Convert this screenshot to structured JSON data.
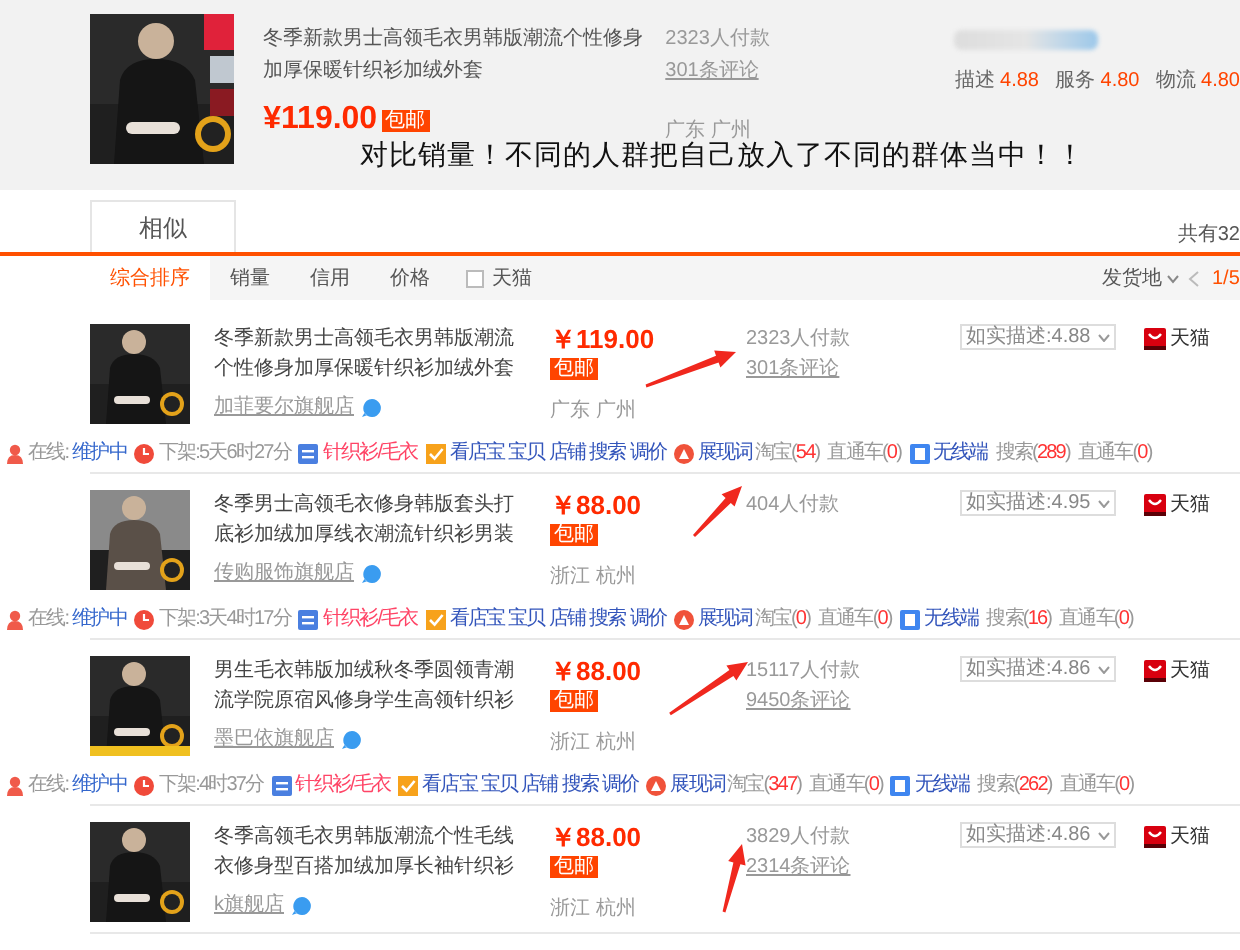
{
  "header_product": {
    "title": "冬季新款男士高领毛衣男韩版潮流个性修身加厚保暖针织衫加绒外套",
    "price": "¥119.00",
    "badge": "包邮",
    "sales": "2323人付款",
    "reviews": "301条评论",
    "location": "广东 广州",
    "ratings": [
      {
        "label": "描述",
        "value": "4.88"
      },
      {
        "label": "服务",
        "value": "4.80"
      },
      {
        "label": "物流",
        "value": "4.80"
      }
    ]
  },
  "annotation": {
    "text": "对比销量！不同的人群把自己放入了不同的群体当中！！"
  },
  "tabs": [
    {
      "label": "相似",
      "selected": true
    }
  ],
  "total_count": "共有32",
  "sort_options": [
    {
      "label": "综合排序",
      "selected": true
    },
    {
      "label": "销量",
      "selected": false
    },
    {
      "label": "信用",
      "selected": false
    },
    {
      "label": "价格",
      "selected": false
    }
  ],
  "tmall_filter": {
    "label": "天猫",
    "checked": false
  },
  "ship_from": "发货地",
  "pager": "1/5",
  "products": [
    {
      "title": "冬季新款男士高领毛衣男韩版潮流个性修身加厚保暖针织衫加绒外套",
      "shop": "加菲要尔旗舰店",
      "price": "￥119.00",
      "badge": "包邮",
      "location": "广东 广州",
      "sales": "2323人付款",
      "reviews": "301条评论",
      "rating": "如实描述:4.88",
      "store_type": "天猫",
      "online_label": "在线:",
      "online_status": "维护中",
      "delist": "下架:5天6时27分",
      "category": "针织衫/毛衣",
      "tools": [
        "看店宝",
        "宝贝",
        "店铺",
        "搜索",
        "调价"
      ],
      "exposure": {
        "label": "展现词",
        "taobao": "淘宝(54)",
        "ztc": "直通车(0)"
      },
      "wireless": {
        "label": "无线端",
        "search": "搜索(289)",
        "ztc": "直通车(0)"
      }
    },
    {
      "title": "冬季男士高领毛衣修身韩版套头打底衫加绒加厚线衣潮流针织衫男装",
      "shop": "传购服饰旗舰店",
      "price": "￥88.00",
      "badge": "包邮",
      "location": "浙江 杭州",
      "sales": "404人付款",
      "rating": "如实描述:4.95",
      "store_type": "天猫",
      "online_label": "在线:",
      "online_status": "维护中",
      "delist": "下架:3天4时17分",
      "category": "针织衫/毛衣",
      "tools": [
        "看店宝",
        "宝贝",
        "店铺",
        "搜索",
        "调价"
      ],
      "exposure": {
        "label": "展现词",
        "taobao": "淘宝(0)",
        "ztc": "直通车(0)"
      },
      "wireless": {
        "label": "无线端",
        "search": "搜索(16)",
        "ztc": "直通车(0)"
      }
    },
    {
      "title": "男生毛衣韩版加绒秋冬季圆领青潮流学院原宿风修身学生高领针织衫",
      "shop": "墨巴依旗舰店",
      "price": "￥88.00",
      "badge": "包邮",
      "location": "浙江 杭州",
      "sales": "15117人付款",
      "reviews": "9450条评论",
      "rating": "如实描述:4.86",
      "store_type": "天猫",
      "online_label": "在线:",
      "online_status": "维护中",
      "delist": "下架:4时37分",
      "category": "针织衫/毛衣",
      "tools": [
        "看店宝",
        "宝贝",
        "店铺",
        "搜索",
        "调价"
      ],
      "exposure": {
        "label": "展现词",
        "taobao": "淘宝(347)",
        "ztc": "直通车(0)"
      },
      "wireless": {
        "label": "无线端",
        "search": "搜索(262)",
        "ztc": "直通车(0)"
      }
    },
    {
      "title": "冬季高领毛衣男韩版潮流个性毛线衣修身型百搭加绒加厚长袖针织衫",
      "shop": "k旗舰店",
      "price": "￥88.00",
      "badge": "包邮",
      "location": "浙江 杭州",
      "sales": "3829人付款",
      "reviews": "2314条评论",
      "rating": "如实描述:4.86",
      "store_type": "天猫"
    }
  ]
}
